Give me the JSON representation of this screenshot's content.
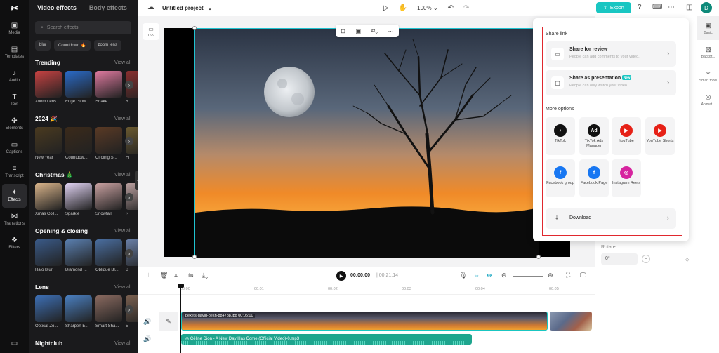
{
  "rail": {
    "items": [
      {
        "label": "Media",
        "icon": "media-icon"
      },
      {
        "label": "Templates",
        "icon": "templates-icon"
      },
      {
        "label": "Audio",
        "icon": "audio-icon"
      },
      {
        "label": "Text",
        "icon": "text-icon"
      },
      {
        "label": "Elements",
        "icon": "elements-icon"
      },
      {
        "label": "Captions",
        "icon": "captions-icon"
      },
      {
        "label": "Transcript",
        "icon": "transcript-icon"
      },
      {
        "label": "Effects",
        "icon": "effects-icon"
      },
      {
        "label": "Transitions",
        "icon": "transitions-icon"
      },
      {
        "label": "Filters",
        "icon": "filters-icon"
      }
    ]
  },
  "panel": {
    "tab_video": "Video effects",
    "tab_body": "Body effects",
    "search_placeholder": "Search effects",
    "chips": [
      "blur",
      "Countdown 🔥",
      "zoom lens"
    ],
    "view_all": "View all",
    "sections": [
      {
        "title": "Trending",
        "items": [
          "Zoom Lens",
          "Edge Glow",
          "Shake",
          "R"
        ]
      },
      {
        "title": "2024 🎉",
        "items": [
          "New Year",
          "Countdow...",
          "Circling S...",
          "Fi"
        ]
      },
      {
        "title": "Christmas 🎄",
        "items": [
          "Xmas Coll...",
          "Sparkle",
          "Snowfall",
          "R"
        ]
      },
      {
        "title": "Opening & closing",
        "items": [
          "Halo Blur",
          "Diamond ...",
          "Oblique Bl...",
          "B"
        ]
      },
      {
        "title": "Lens",
        "items": [
          "Optical Zo...",
          "Sharpen E...",
          "Smart Sha...",
          "E"
        ]
      },
      {
        "title": "Nightclub",
        "items": []
      }
    ]
  },
  "topbar": {
    "project": "Untitled project",
    "zoom": "100%",
    "export": "Export",
    "avatar": "D"
  },
  "canvas": {
    "ratio": "16:9"
  },
  "side": {
    "rotate_label": "Rotate",
    "rotate_value": "0°"
  },
  "rtabs": [
    {
      "label": "Basic",
      "icon": "basic-icon"
    },
    {
      "label": "Backgr...",
      "icon": "background-icon"
    },
    {
      "label": "Smart tools",
      "icon": "smart-tools-icon"
    },
    {
      "label": "Animat...",
      "icon": "animation-icon"
    }
  ],
  "share": {
    "share_link": "Share link",
    "review_title": "Share for review",
    "review_sub": "People can add comments to your video.",
    "present_title": "Share as presentation",
    "present_badge": "New",
    "present_sub": "People can only watch your video.",
    "more_options": "More options",
    "options": [
      {
        "label": "TikTok",
        "color": "#111111",
        "glyph": "♪"
      },
      {
        "label": "TikTok Ads Manager",
        "color": "#111111",
        "glyph": "Ad"
      },
      {
        "label": "YouTube",
        "color": "#e62117",
        "glyph": "▶"
      },
      {
        "label": "YouTube Shorts",
        "color": "#e62117",
        "glyph": "▶"
      },
      {
        "label": "Facebook group",
        "color": "#1877f2",
        "glyph": "f"
      },
      {
        "label": "Facebook Page",
        "color": "#1877f2",
        "glyph": "f"
      },
      {
        "label": "Instagram Reels",
        "color": "#d6249f",
        "glyph": "◎"
      }
    ],
    "download": "Download"
  },
  "timeline": {
    "current": "00:00:00",
    "total": "00:21:14",
    "ticks": [
      "00:00",
      "00:01",
      "00:02",
      "00:03",
      "00:04",
      "00:05"
    ],
    "video_clip": "pexels-david-besh-884788.jpg   00:05:00",
    "audio_clip": "Céline Dion - A New Day Has Come (Official Video)-0.mp3"
  }
}
